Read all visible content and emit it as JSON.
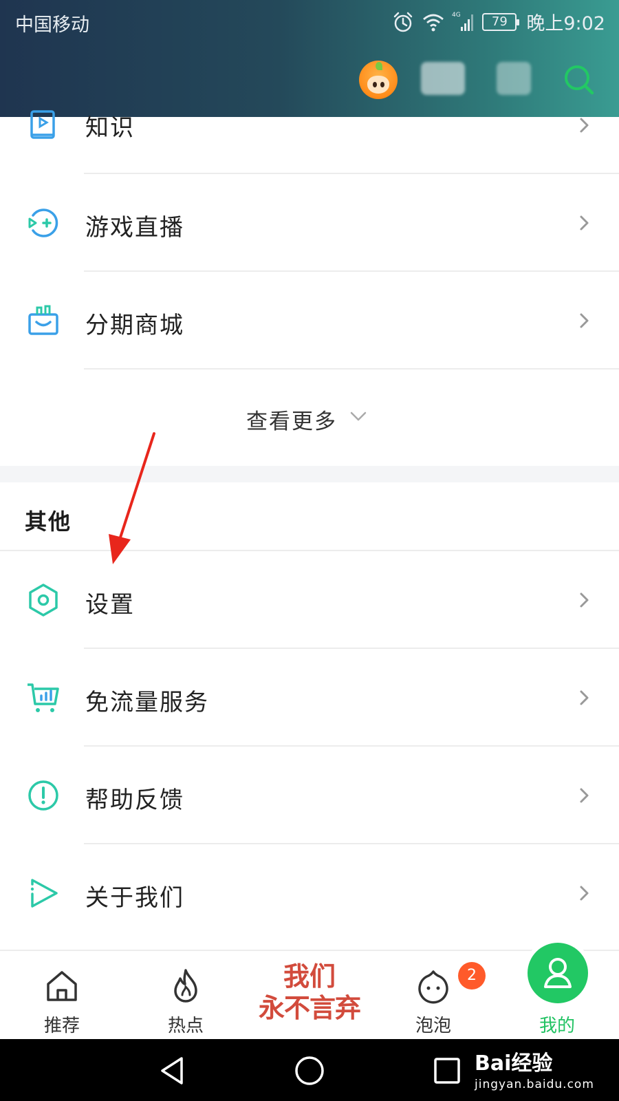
{
  "status_bar": {
    "carrier": "中国移动",
    "network": "4G",
    "battery": "79",
    "time": "晚上9:02"
  },
  "toolbar": {
    "avatar_icon": "orange-cartoon-avatar",
    "search_icon": "search-icon"
  },
  "menu": {
    "items": [
      {
        "label": "知识",
        "icon": "book-play-icon"
      },
      {
        "label": "游戏直播",
        "icon": "game-live-icon"
      },
      {
        "label": "分期商城",
        "icon": "shopping-bag-icon"
      }
    ],
    "more_label": "查看更多"
  },
  "other": {
    "title": "其他",
    "items": [
      {
        "label": "设置",
        "icon": "settings-hexagon-icon"
      },
      {
        "label": "免流量服务",
        "icon": "cart-data-icon"
      },
      {
        "label": "帮助反馈",
        "icon": "exclamation-circle-icon"
      },
      {
        "label": "关于我们",
        "icon": "play-triangle-icon"
      }
    ]
  },
  "bottom_nav": {
    "home": "推荐",
    "hot": "热点",
    "slogan_line1": "我们",
    "slogan_line2": "永不言弃",
    "bubble": "泡泡",
    "bubble_badge": "2",
    "mine": "我的",
    "active_color": "#22c864"
  },
  "watermark": {
    "brand": "Bai经验",
    "url": "jingyan.baidu.com"
  },
  "colors": {
    "accent_green": "#22c864",
    "icon_teal": "#2cc9a8",
    "icon_blue": "#3aa0e8",
    "annotation_red": "#e8261c"
  }
}
